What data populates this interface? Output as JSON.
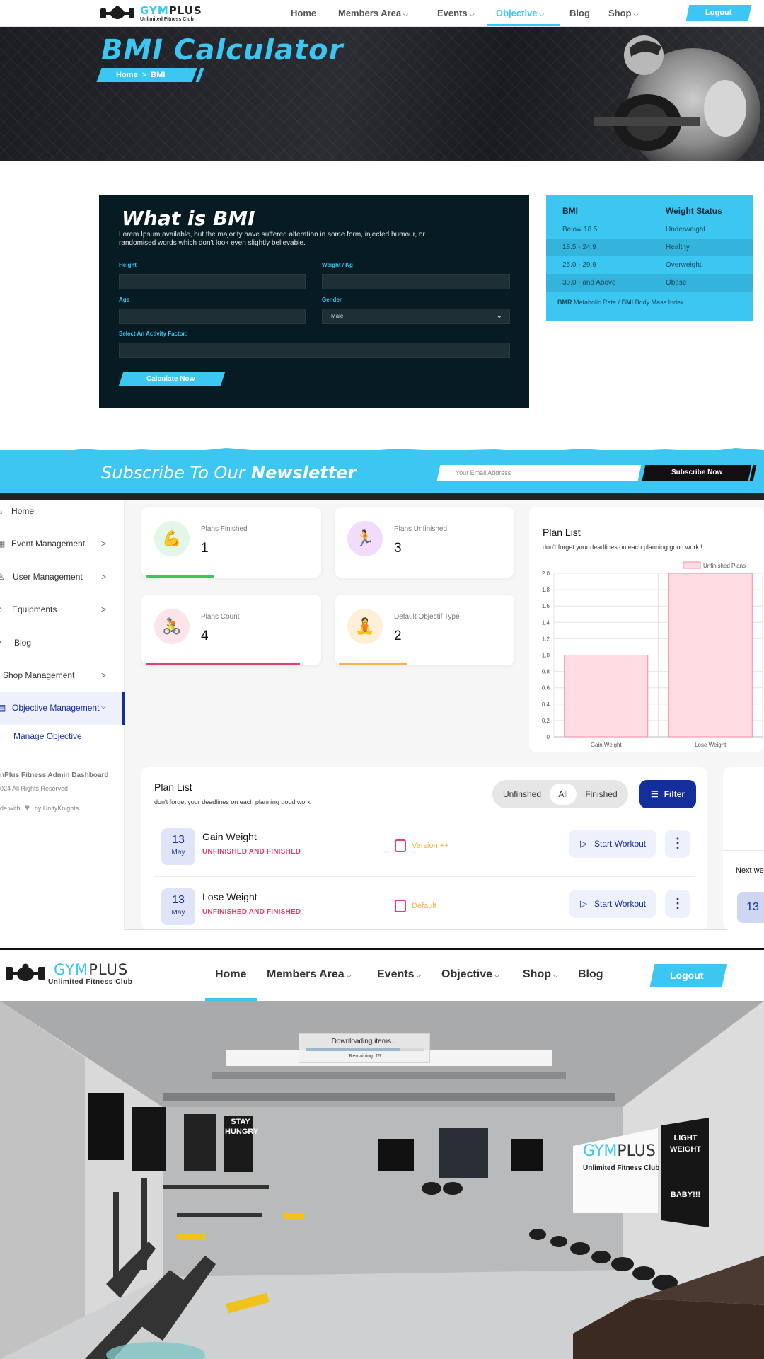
{
  "site": {
    "brand_a": "GYM",
    "brand_b": "PLUS",
    "tagline": "Unlimited Fitness Club"
  },
  "header1": {
    "nav": [
      "Home",
      "Members Area",
      "Events",
      "Objective",
      "Blog",
      "Shop"
    ],
    "active": "Objective",
    "logout": "Logout"
  },
  "hero": {
    "title": "BMI Calculator",
    "crumb_home": "Home",
    "crumb_sep": ">",
    "crumb_current": "BMI"
  },
  "bmi_form": {
    "title": "What is BMI",
    "description": "Lorem Ipsum available, but the majority have suffered alteration in some form, injected humour, or randomised words which don't look even slightly believable.",
    "height_label": "Height",
    "weight_label": "Weight / Kg",
    "age_label": "Age",
    "gender_label": "Gender",
    "gender_value": "Male",
    "activity_label": "Select An Activity Factor:",
    "submit": "Calculate Now"
  },
  "bmi_table": {
    "col1": "BMI",
    "col2": "Weight Status",
    "rows": [
      {
        "range": "Below 18.5",
        "status": "Underweight"
      },
      {
        "range": "18.5 - 24.9",
        "status": "Healthy"
      },
      {
        "range": "25.0 - 29.9",
        "status": "Overweight"
      },
      {
        "range": "30.0 - and Above",
        "status": "Obese"
      }
    ],
    "note_a": "BMR",
    "note_b": "Metabolic Rate /",
    "note_c": "BMI",
    "note_d": "Body Mass Index"
  },
  "newsletter": {
    "title_a": "Subscribe To Our",
    "title_b": "Newsletter",
    "placeholder": "Your Email Address",
    "button": "Subscribe Now"
  },
  "sidebar": {
    "items": [
      {
        "label": "Home",
        "arrow": ""
      },
      {
        "label": "Event Management",
        "arrow": ">"
      },
      {
        "label": "User Management",
        "arrow": ">"
      },
      {
        "label": "Equipments",
        "arrow": ">"
      },
      {
        "label": "Blog",
        "arrow": ""
      },
      {
        "label": "Shop Management",
        "arrow": ">"
      },
      {
        "label": "Objective Management",
        "arrow": "v"
      }
    ],
    "sub_item": "Manage Objective",
    "footer_1": "nPlus Fitness Admin Dashboard",
    "footer_2": "024 All Rights Reserved",
    "footer_3": "de with",
    "footer_4": "by UnityKnights"
  },
  "stats": [
    {
      "label": "Plans Finished",
      "value": "1",
      "color": "#3fc35e",
      "icon": "muscle-icon",
      "progress": 0.4
    },
    {
      "label": "Plans Unfinished",
      "value": "3",
      "color": "#b33df0",
      "icon": "running-icon",
      "progress": 0
    },
    {
      "label": "Plans Count",
      "value": "4",
      "color": "#e93d6b",
      "icon": "cycling-icon",
      "progress": 0.9
    },
    {
      "label": "Default Objectif Type",
      "value": "2",
      "color": "#f5b548",
      "icon": "meditation-icon",
      "progress": 0.4
    }
  ],
  "chart_panel": {
    "title": "Plan List",
    "subtitle": "don't forget your deadlines on each planning good work !"
  },
  "chart_data": {
    "type": "bar",
    "categories": [
      "Gain Weight",
      "Lose Weight"
    ],
    "series": [
      {
        "name": "Unfinished Plans",
        "values": [
          1,
          2
        ]
      }
    ],
    "ylim": [
      0,
      2
    ],
    "yticks": [
      "0",
      "0.2",
      "0.4",
      "0.6",
      "0.8",
      "1.0",
      "1.2",
      "1.4",
      "1.6",
      "1.8",
      "2.0"
    ],
    "bar_color": "#ffdce4",
    "bar_border": "#f08aa4",
    "grid": true,
    "legend": "top-right"
  },
  "plan_list": {
    "title": "Plan List",
    "subtitle": "don't forget your deadlines on each planning good work !",
    "filters": [
      "Unfinshed",
      "All",
      "Finished"
    ],
    "active_filter": "All",
    "filter_button": "Filter",
    "rows": [
      {
        "day": "13",
        "month": "May",
        "name": "Gain Weight",
        "status": "UNFINISHED AND FINISHED",
        "type": "Version ++",
        "action": "Start Workout"
      },
      {
        "day": "13",
        "month": "May",
        "name": "Lose Weight",
        "status": "UNFINISHED AND FINISHED",
        "type": "Default",
        "action": "Start Workout"
      }
    ]
  },
  "next_card": {
    "label": "Next we",
    "day": "13"
  },
  "header3": {
    "nav": [
      "Home",
      "Members Area",
      "Events",
      "Objective",
      "Shop",
      "Blog"
    ],
    "active": "Home",
    "logout": "Logout"
  },
  "gym_scene": {
    "loading_title": "Downloading items...",
    "loading_remaining": "Remaining: 15",
    "poster_1": "STAY",
    "poster_2": "HUNGRY",
    "poster_3": "LIGHT",
    "poster_4": "WEIGHT",
    "poster_5": "BABY!!!",
    "wall_brand_a": "GYM",
    "wall_brand_b": "PLUS",
    "wall_tagline": "Unlimited Fitness Club"
  }
}
